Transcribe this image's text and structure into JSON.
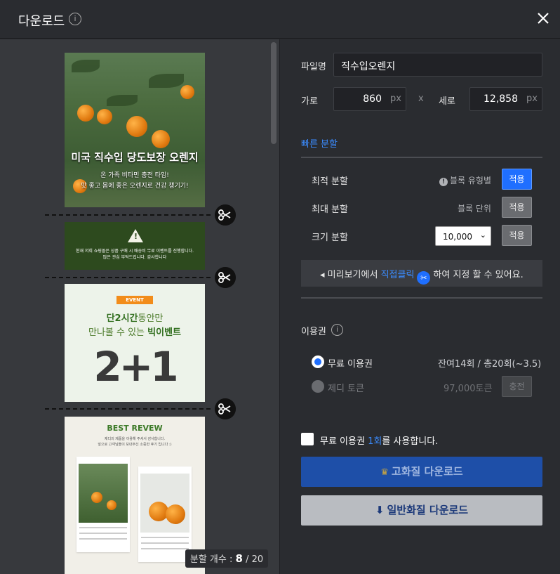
{
  "header": {
    "title": "다운로드",
    "info_glyph": "i"
  },
  "preview": {
    "image1": {
      "title": "미국 직수입 당도보장 오렌지",
      "line1": "온 가족 비타민 충전 타임!",
      "line2": "맛 좋고 몸에 좋은 오렌지로 건강 챙기기!"
    },
    "image2": {
      "line1": "현재 저희 쇼핑몰은 상품 구매 시 배송비 무료 이벤트를 진행합니다.",
      "line2": "많은 관심 부탁드립니다. 감사합니다"
    },
    "image3": {
      "badge": "EVENT",
      "line1_bold": "단2시간",
      "line1_rest": "동안만",
      "line2_rest": "만나볼 수 있는 ",
      "line2_bold": "빅이벤트",
      "big": "2+1"
    },
    "image4": {
      "title": "BEST REVEW",
      "line1": "제디의 제품을 이용해 주셔서 감사합니다.",
      "line2": "앞으로 고객님들이 보내주신 소중한 후기 입니다 :)"
    },
    "count": {
      "label": "분할 개수 : ",
      "current": "8",
      "total": " / 20"
    }
  },
  "form": {
    "filename_label": "파일명",
    "filename_value": "직수입오렌지",
    "width_label": "가로",
    "width_value": "860",
    "width_unit": "px",
    "x_sep": "x",
    "height_label": "세로",
    "height_value": "12,858",
    "height_unit": "px"
  },
  "quick_split": {
    "title": "빠른 분할",
    "optimal": {
      "label": "최적 분할",
      "note_icon": "!",
      "note": "블록 유형별",
      "button": "적용"
    },
    "max": {
      "label": "최대 분할",
      "note": "블록 단위",
      "button": "적용"
    },
    "size": {
      "label": "크기 분할",
      "select_value": "10,000",
      "button": "적용"
    },
    "hint": {
      "prefix": "◂ 미리보기에서 ",
      "highlight": "직접클릭",
      "suffix": "하여 지정 할 수 있어요."
    }
  },
  "license": {
    "title": "이용권",
    "free": {
      "label": "무료 이용권",
      "status": "잔여14회 / 총20회(~3.5)"
    },
    "token": {
      "label": "제디 토큰",
      "status": "97,000토큰",
      "button": "충전"
    },
    "checkbox_prefix": "무료 이용권 ",
    "checkbox_count": "1회",
    "checkbox_suffix": "를 사용합니다."
  },
  "actions": {
    "hq_label": "고화질 다운로드",
    "nq_label": "일반화질 다운로드"
  }
}
